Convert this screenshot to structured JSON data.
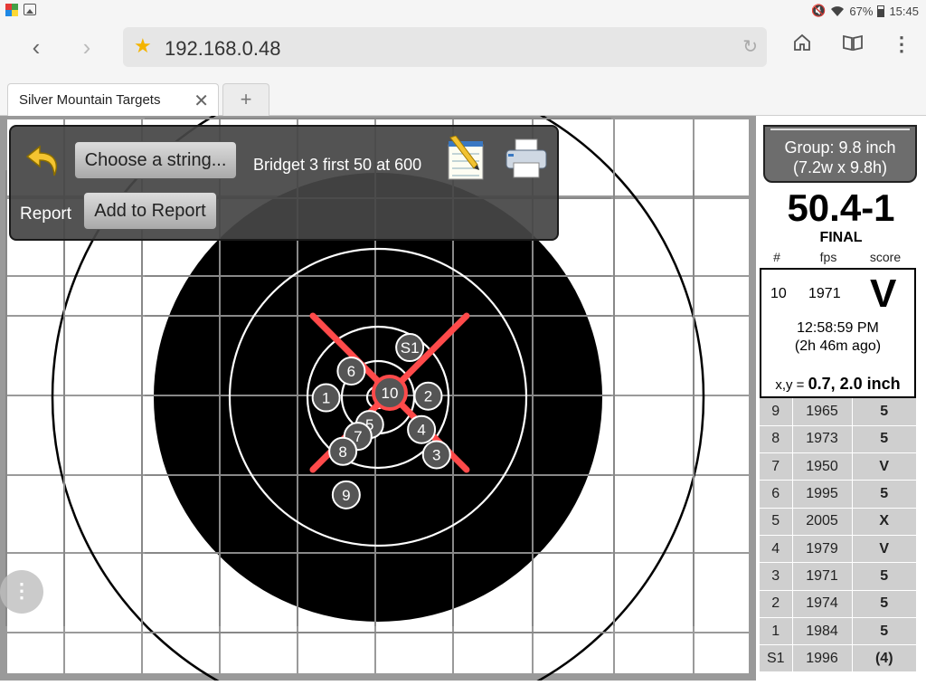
{
  "status_bar": {
    "battery": "67%",
    "time": "15:45"
  },
  "browser": {
    "url": "192.168.0.48",
    "tab_title": "Silver Mountain Targets",
    "new_tab": "+"
  },
  "toolbar": {
    "choose_label": "Choose a string...",
    "string_name": "Bridget 3 first 50 at 600",
    "report_label": "Report",
    "add_report_label": "Add to Report"
  },
  "fab_label": "⋮",
  "target": {
    "shots": [
      {
        "label": "S1",
        "x": 1.9,
        "y": 4.7
      },
      {
        "label": "1",
        "x": -3.1,
        "y": 1.7
      },
      {
        "label": "2",
        "x": 3.0,
        "y": 1.8
      },
      {
        "label": "3",
        "x": 3.5,
        "y": -1.7
      },
      {
        "label": "4",
        "x": 2.6,
        "y": -0.2
      },
      {
        "label": "5",
        "x": -0.5,
        "y": 0.1
      },
      {
        "label": "6",
        "x": -1.6,
        "y": 3.3
      },
      {
        "label": "7",
        "x": -1.2,
        "y": -0.6
      },
      {
        "label": "8",
        "x": -2.1,
        "y": -1.5
      },
      {
        "label": "9",
        "x": -1.9,
        "y": -4.1
      },
      {
        "label": "10",
        "x": 0.7,
        "y": 2.0
      }
    ],
    "selected": "10",
    "colors": {
      "black": "#000000",
      "ring": "#ffffff",
      "marker": "#ff4a4a",
      "badge": "#555555",
      "grid": "#9a9a9a"
    }
  },
  "group": {
    "line1": "Group: 9.8 inch",
    "line2": "(7.2w x 9.8h)"
  },
  "score": {
    "total": "50.4-1",
    "status": "FINAL"
  },
  "headers": {
    "num": "#",
    "fps": "fps",
    "score": "score"
  },
  "selected_shot": {
    "num": "10",
    "fps": "1971",
    "score": "V",
    "time": "12:58:59 PM",
    "ago": "(2h 46m ago)",
    "xy_label": "x,y = ",
    "xy_value": "0.7, 2.0 inch"
  },
  "shot_list": [
    {
      "num": "9",
      "fps": "1965",
      "score": "5"
    },
    {
      "num": "8",
      "fps": "1973",
      "score": "5"
    },
    {
      "num": "7",
      "fps": "1950",
      "score": "V"
    },
    {
      "num": "6",
      "fps": "1995",
      "score": "5"
    },
    {
      "num": "5",
      "fps": "2005",
      "score": "X"
    },
    {
      "num": "4",
      "fps": "1979",
      "score": "V"
    },
    {
      "num": "3",
      "fps": "1971",
      "score": "5"
    },
    {
      "num": "2",
      "fps": "1974",
      "score": "5"
    },
    {
      "num": "1",
      "fps": "1984",
      "score": "5"
    },
    {
      "num": "S1",
      "fps": "1996",
      "score": "(4)"
    }
  ]
}
